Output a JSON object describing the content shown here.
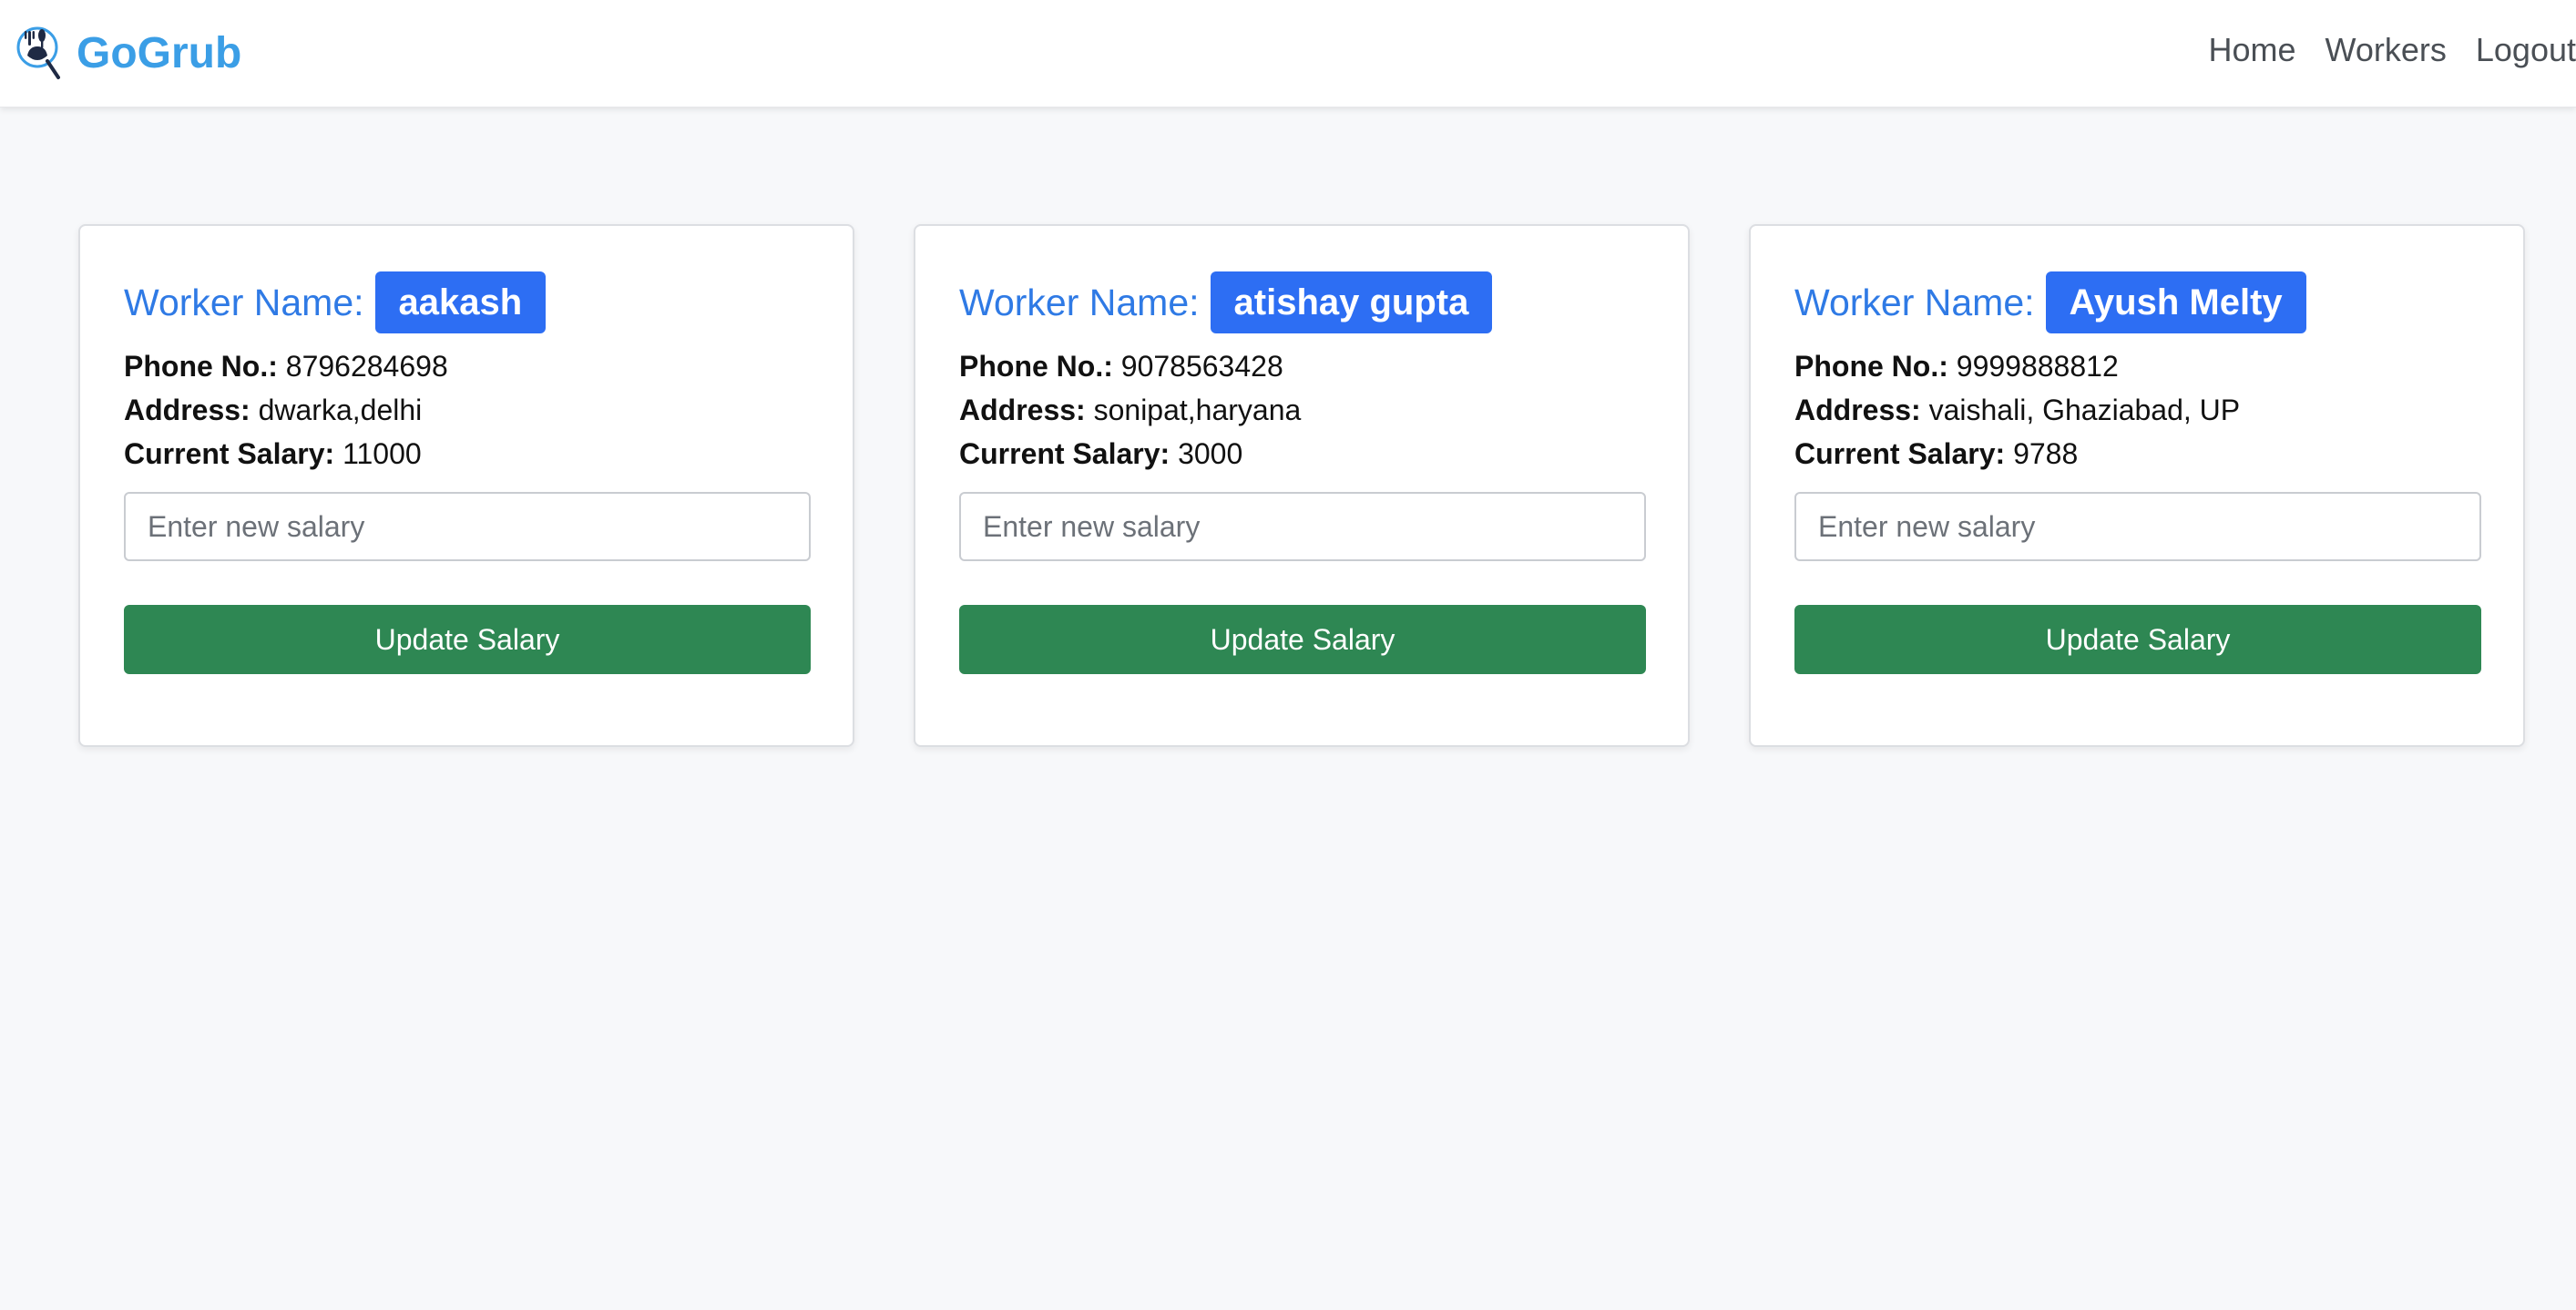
{
  "brand": {
    "name": "GoGrub",
    "logo_icon": "chef-logo-icon",
    "color": "#3b9ee6"
  },
  "nav": {
    "items": [
      {
        "label": "Home"
      },
      {
        "label": "Workers"
      },
      {
        "label": "Logout"
      }
    ]
  },
  "workers": [
    {
      "title_label": "Worker Name:",
      "name": "aakash",
      "phone_label": "Phone No.:",
      "phone": "8796284698",
      "address_label": "Address:",
      "address": "dwarka,delhi",
      "salary_label": "Current Salary:",
      "salary": "11000",
      "input_placeholder": "Enter new salary",
      "input_value": "",
      "button_label": "Update Salary"
    },
    {
      "title_label": "Worker Name:",
      "name": "atishay gupta",
      "phone_label": "Phone No.:",
      "phone": "9078563428",
      "address_label": "Address:",
      "address": "sonipat,haryana",
      "salary_label": "Current Salary:",
      "salary": "3000",
      "input_placeholder": "Enter new salary",
      "input_value": "",
      "button_label": "Update Salary"
    },
    {
      "title_label": "Worker Name:",
      "name": "Ayush Melty",
      "phone_label": "Phone No.:",
      "phone": "9999888812",
      "address_label": "Address:",
      "address": "vaishali, Ghaziabad, UP",
      "salary_label": "Current Salary:",
      "salary": "9788",
      "input_placeholder": "Enter new salary",
      "input_value": "",
      "button_label": "Update Salary"
    }
  ],
  "colors": {
    "title_label": "#2f7ae5",
    "badge_bg": "#2d6ef3",
    "button_bg": "#2e8753",
    "page_bg": "#f7f8fa"
  }
}
